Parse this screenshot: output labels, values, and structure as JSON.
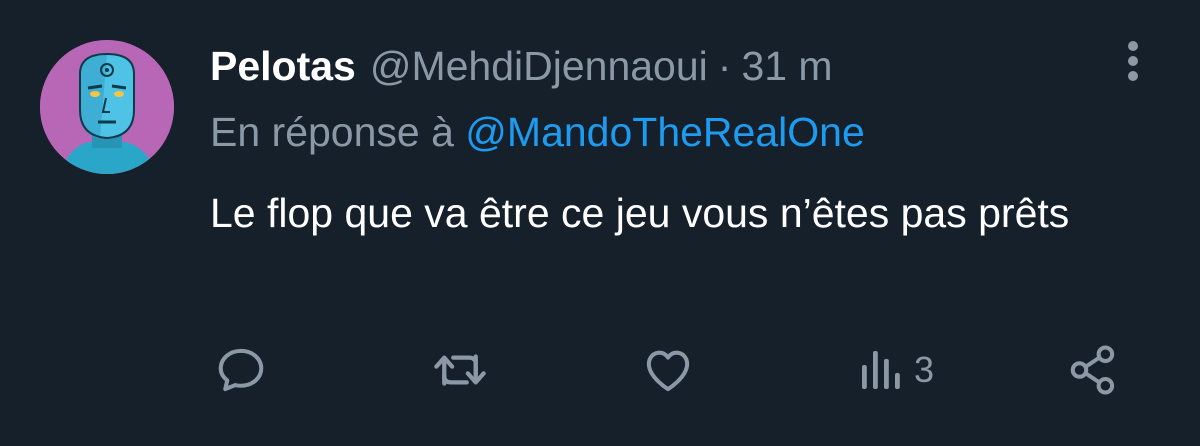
{
  "tweet": {
    "display_name": "Pelotas",
    "handle": "@MehdiDjennaoui",
    "separator": "·",
    "time": "31 m",
    "reply_prefix": "En réponse à ",
    "reply_to": "@MandoTheRealOne",
    "text": "Le flop que va être ce jeu vous n’êtes pas prêts"
  },
  "actions": {
    "reply_icon": "reply-icon",
    "retweet_icon": "retweet-icon",
    "like_icon": "heart-icon",
    "views_icon": "views-icon",
    "views_count": "3",
    "share_icon": "share-icon"
  },
  "colors": {
    "background": "#15202b",
    "text_primary": "#ffffff",
    "text_secondary": "#8b98a5",
    "link": "#1d9bf0",
    "avatar_bg": "#b866b6"
  }
}
